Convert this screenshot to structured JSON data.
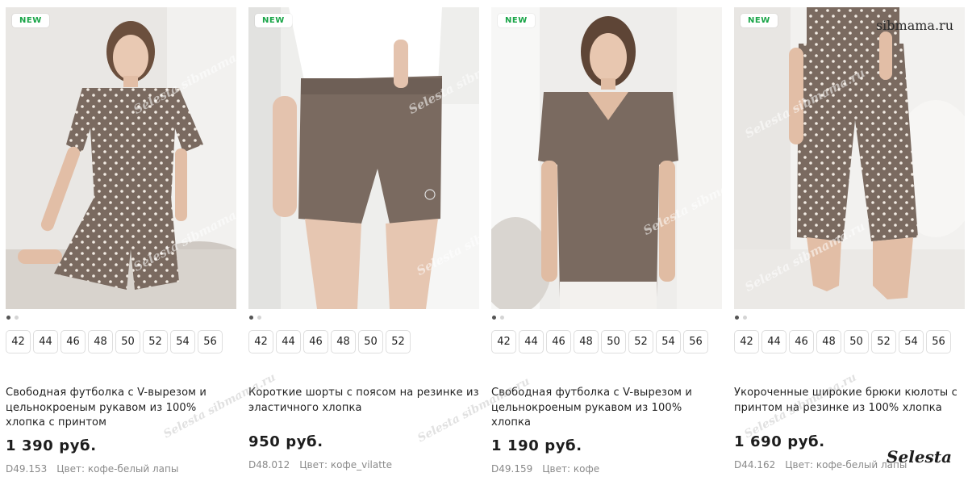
{
  "products": [
    {
      "badge": "NEW",
      "image_icon": "product-photo-tshirt-shorts",
      "sizes": [
        "42",
        "44",
        "46",
        "48",
        "50",
        "52",
        "54",
        "56"
      ],
      "title": "Свободная футболка с V-вырезом и цельнокроеным рукавом из 100% хлопка с принтом",
      "price": "1 390 руб.",
      "code": "D49.153",
      "color": "Цвет: кофе-белый лапы"
    },
    {
      "badge": "NEW",
      "image_icon": "product-photo-shorts",
      "sizes": [
        "42",
        "44",
        "46",
        "48",
        "50",
        "52"
      ],
      "title": "Короткие шорты с поясом на резинке из эластичного хлопка",
      "price": "950 руб.",
      "code": "D48.012",
      "color": "Цвет: кофе_vilatte"
    },
    {
      "badge": "NEW",
      "image_icon": "product-photo-tshirt",
      "sizes": [
        "42",
        "44",
        "46",
        "48",
        "50",
        "52",
        "54",
        "56"
      ],
      "title": "Свободная футболка с V-вырезом и цельнокроеным рукавом из 100% хлопка",
      "price": "1 190 руб.",
      "code": "D49.159",
      "color": "Цвет: кофе"
    },
    {
      "badge": "NEW",
      "image_icon": "product-photo-culottes",
      "sizes": [
        "42",
        "44",
        "46",
        "48",
        "50",
        "52",
        "54",
        "56"
      ],
      "title": "Укороченные широкие брюки кюлоты с принтом на резинке из 100% хлопка",
      "price": "1 690 руб.",
      "code": "D44.162",
      "color": "Цвет: кофе-белый лапы"
    }
  ],
  "watermarks": {
    "site": "sibmama.ru",
    "brand": "Selesta",
    "photo": "Selesta sibmama.ru"
  },
  "colors": {
    "badge_text": "#1aa548",
    "fabric": "#7a6a60",
    "print": "#f3ece4"
  }
}
